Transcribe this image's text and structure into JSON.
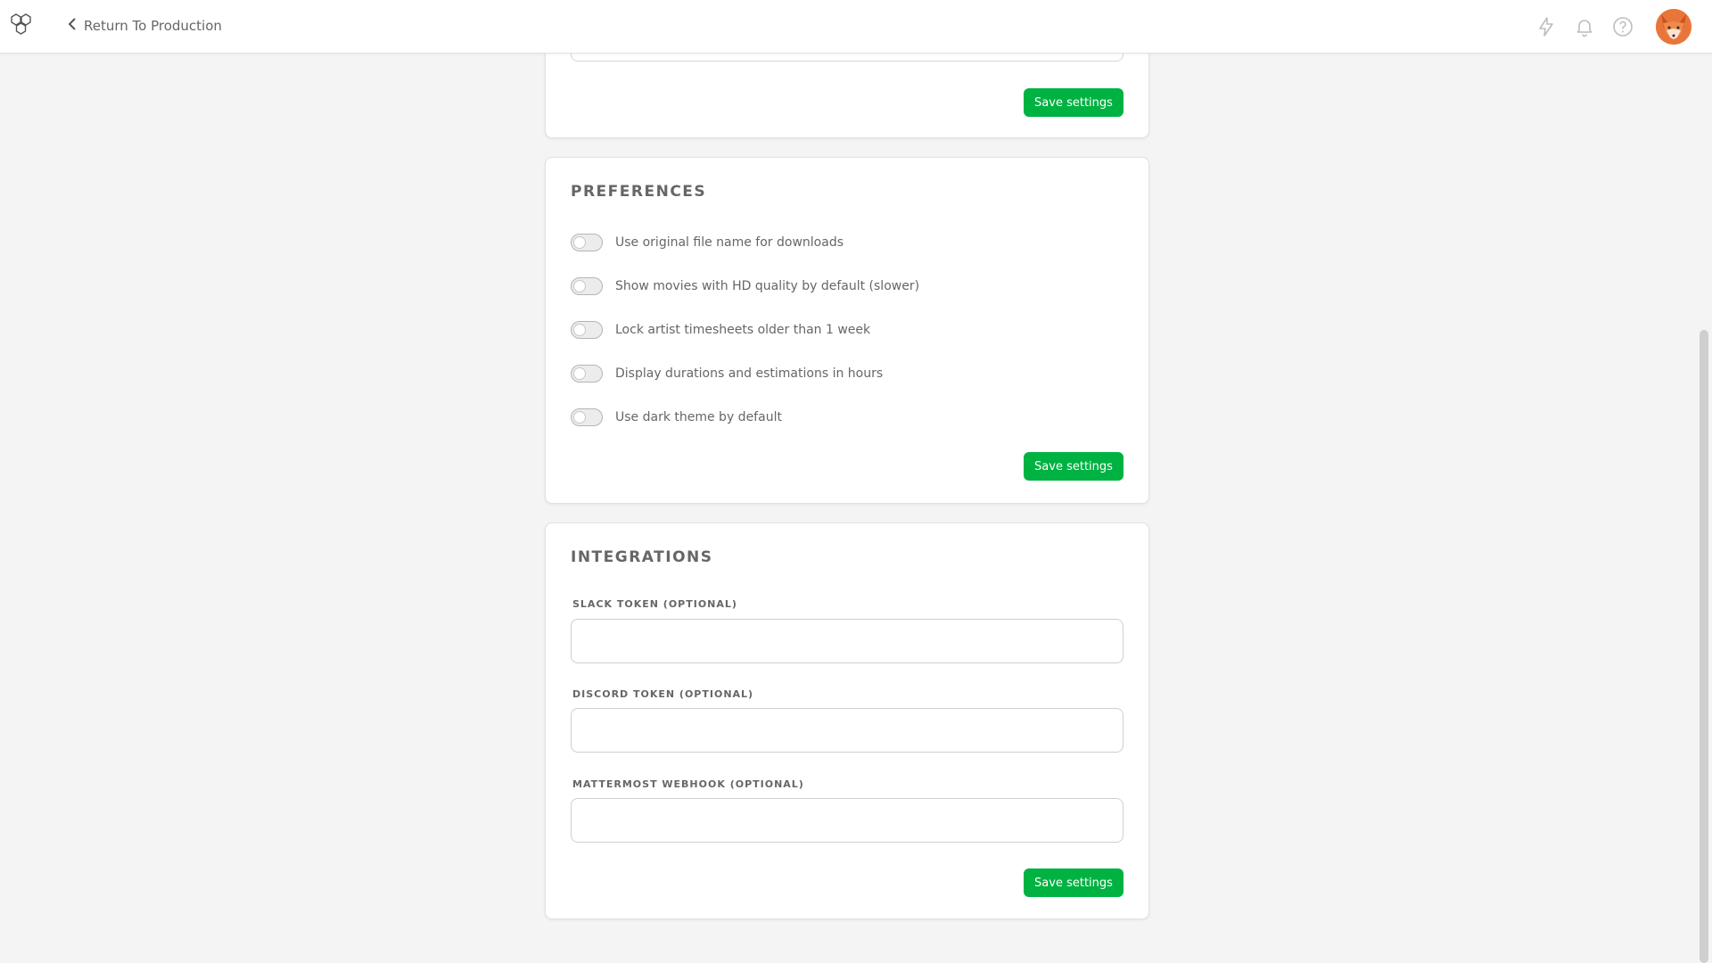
{
  "header": {
    "back_label": "Return To Production"
  },
  "icons": {
    "logo": "hexagon-logo-icon",
    "back": "chevron-left-icon",
    "news": "lightning-icon",
    "notifications": "bell-icon",
    "help": "help-circle-icon",
    "avatar": "fox-avatar"
  },
  "colors": {
    "accent": "#00b242",
    "background": "#f4f4f4",
    "card": "#ffffff",
    "text": "#666666"
  },
  "top_section": {
    "save_label": "Save settings"
  },
  "preferences": {
    "title": "PREFERENCES",
    "toggles": [
      {
        "label": "Use original file name for downloads",
        "checked": false
      },
      {
        "label": "Show movies with HD quality by default (slower)",
        "checked": false
      },
      {
        "label": "Lock artist timesheets older than 1 week",
        "checked": false
      },
      {
        "label": "Display durations and estimations in hours",
        "checked": false
      },
      {
        "label": "Use dark theme by default",
        "checked": false
      }
    ],
    "save_label": "Save settings"
  },
  "integrations": {
    "title": "INTEGRATIONS",
    "fields": [
      {
        "label": "SLACK TOKEN (OPTIONAL)",
        "value": ""
      },
      {
        "label": "DISCORD TOKEN (OPTIONAL)",
        "value": ""
      },
      {
        "label": "MATTERMOST WEBHOOK (OPTIONAL)",
        "value": ""
      }
    ],
    "save_label": "Save settings"
  }
}
